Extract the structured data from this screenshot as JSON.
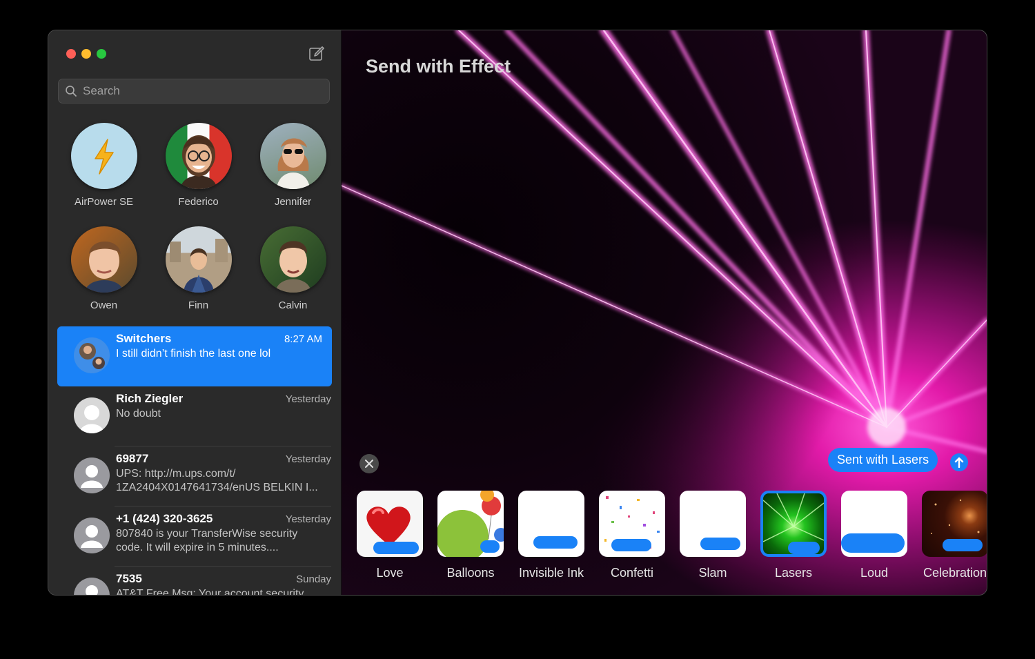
{
  "window": {
    "traffic_lights": [
      "#fe5f57",
      "#febc2e",
      "#28c840"
    ]
  },
  "sidebar": {
    "compose_icon": "compose-icon",
    "search": {
      "placeholder": "Search",
      "value": ""
    },
    "pinned": [
      {
        "name": "AirPower SE"
      },
      {
        "name": "Federico"
      },
      {
        "name": "Jennifer"
      },
      {
        "name": "Owen"
      },
      {
        "name": "Finn"
      },
      {
        "name": "Calvin"
      }
    ],
    "conversations": [
      {
        "title": "Switchers",
        "time": "8:27 AM",
        "message": "I still didn’t finish the last one lol",
        "selected": true
      },
      {
        "title": "Rich Ziegler",
        "time": "Yesterday",
        "message": "No doubt"
      },
      {
        "title": "69877",
        "time": "Yesterday",
        "message": "UPS: http://m.ups.com/t/ 1ZA2404X0147641734/enUS BELKIN I..."
      },
      {
        "title": "+1 (424) 320-3625",
        "time": "Yesterday",
        "message": "807840 is your TransferWise security code. It will expire in 5 minutes...."
      },
      {
        "title": "7535",
        "time": "Sunday",
        "message": "AT&T Free Msg: Your account security"
      }
    ]
  },
  "main": {
    "title": "Send with Effect",
    "bubble_text": "Sent with Lasers",
    "accent": "#1a82f7",
    "effects": [
      {
        "label": "Love"
      },
      {
        "label": "Balloons"
      },
      {
        "label": "Invisible Ink"
      },
      {
        "label": "Confetti"
      },
      {
        "label": "Slam"
      },
      {
        "label": "Lasers",
        "selected": true
      },
      {
        "label": "Loud"
      },
      {
        "label": "Celebration"
      }
    ]
  }
}
